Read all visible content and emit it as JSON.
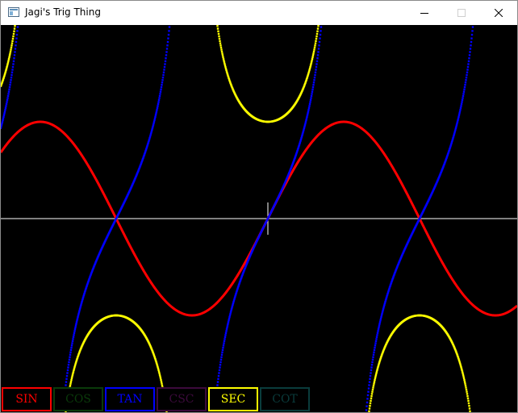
{
  "window": {
    "title": "Jagi's Trig Thing"
  },
  "buttons": [
    {
      "id": "sin",
      "label": "SIN",
      "color": "#ff0000",
      "active": true
    },
    {
      "id": "cos",
      "label": "COS",
      "color": "#0a3b0a",
      "active": false
    },
    {
      "id": "tan",
      "label": "TAN",
      "color": "#0000ff",
      "active": true
    },
    {
      "id": "csc",
      "label": "CSC",
      "color": "#3c0a3c",
      "active": false
    },
    {
      "id": "sec",
      "label": "SEC",
      "color": "#ffff00",
      "active": true
    },
    {
      "id": "cot",
      "label": "COT",
      "color": "#0a3c3c",
      "active": false
    }
  ],
  "colors": {
    "background": "#000000",
    "axis": "#ffffff"
  }
}
